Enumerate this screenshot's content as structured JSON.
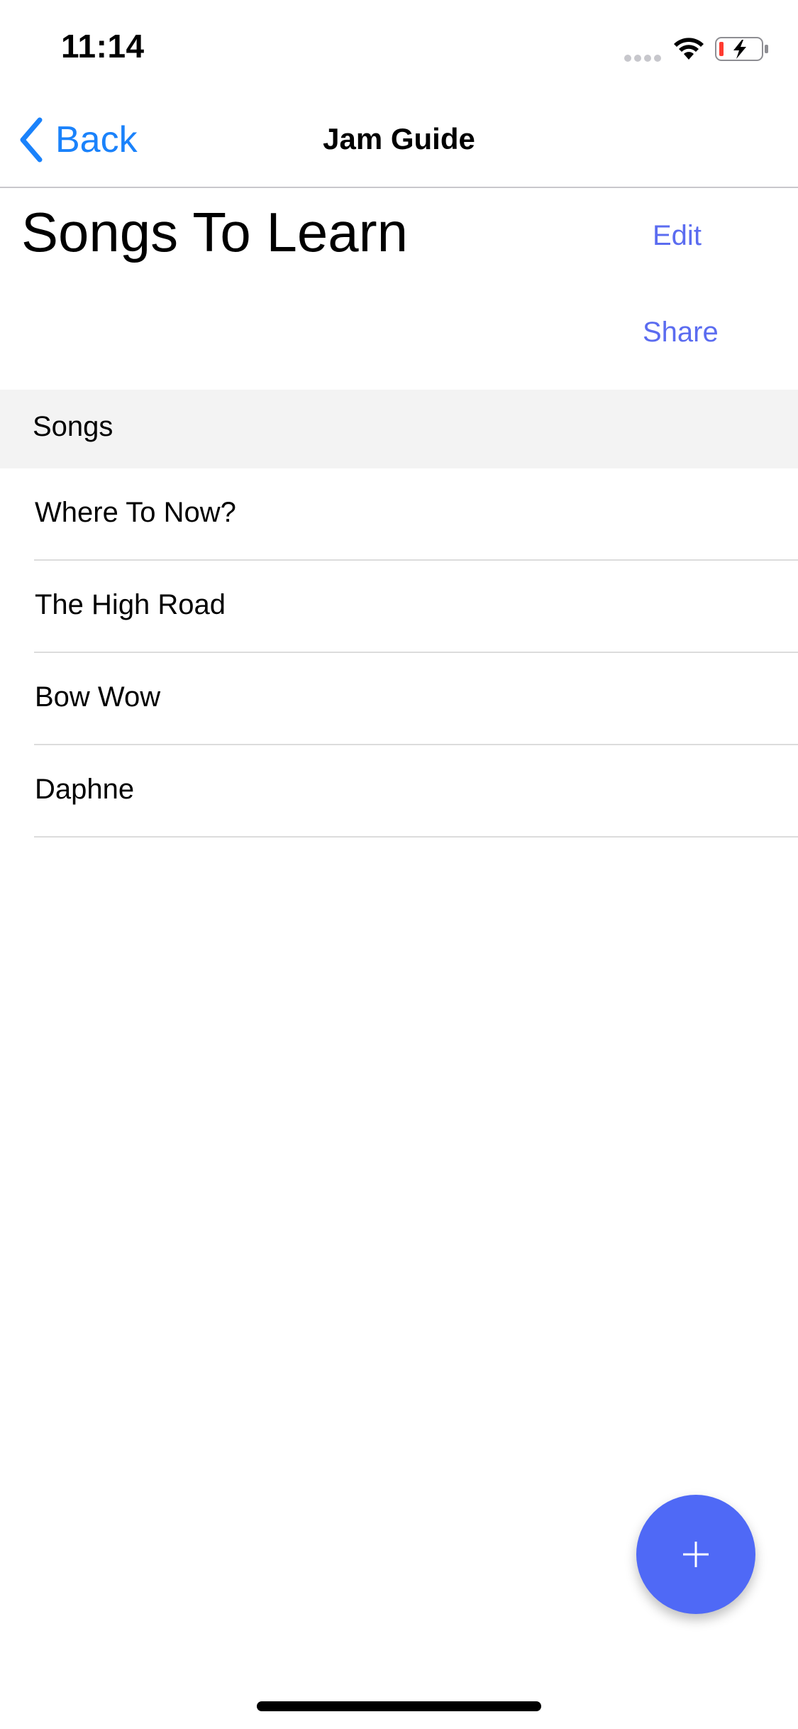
{
  "status_bar": {
    "time": "11:14",
    "signal_icon": "signal-dots-icon",
    "wifi_icon": "wifi-icon",
    "battery_icon": "battery-charging-icon"
  },
  "nav": {
    "back_label": "Back",
    "back_icon": "chevron-left-icon",
    "title": "Jam Guide"
  },
  "header": {
    "title": "Songs To Learn",
    "edit_label": "Edit",
    "share_label": "Share"
  },
  "section": {
    "label": "Songs"
  },
  "songs": [
    {
      "title": "Where To Now?"
    },
    {
      "title": "The High Road"
    },
    {
      "title": "Bow Wow"
    },
    {
      "title": "Daphne"
    }
  ],
  "fab": {
    "icon": "plus-icon"
  },
  "colors": {
    "accent_blue": "#1a82fb",
    "action_blue": "#5b6cf0",
    "fab_blue": "#4f69f6",
    "section_bg": "#f3f3f3"
  }
}
